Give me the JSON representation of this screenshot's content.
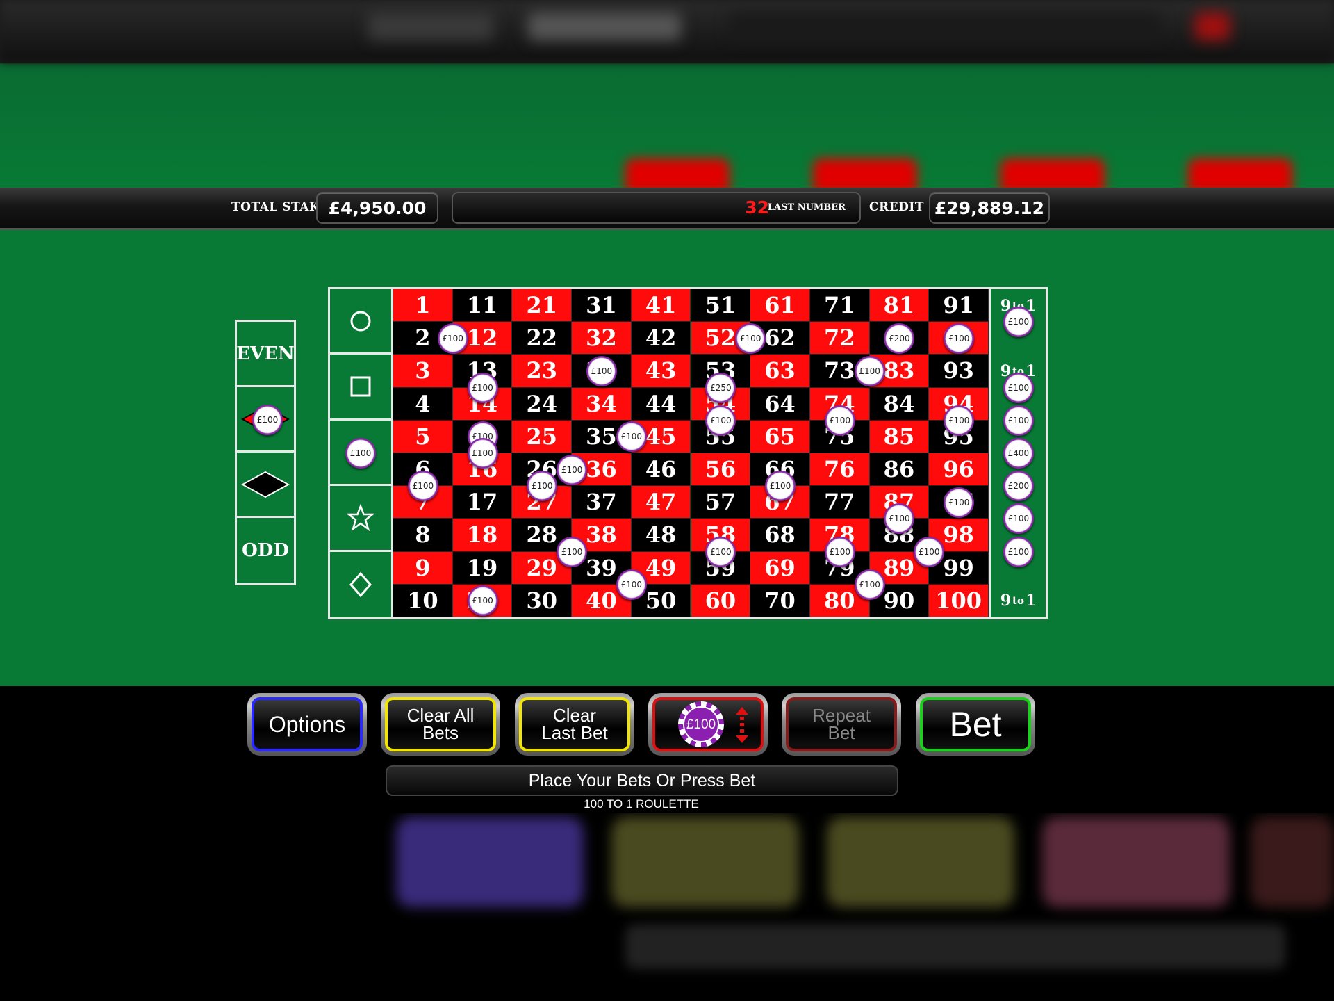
{
  "info_bar": {
    "total_stake_label": "TOTAL STAKE",
    "total_stake_value": "£4,950.00",
    "last_number_value": "32",
    "last_number_label": "LAST NUMBER",
    "credit_label": "CREDIT",
    "credit_value": "£29,889.12"
  },
  "side_bets": [
    "EVEN",
    "",
    "",
    "ODD"
  ],
  "payout_label": {
    "nine": "9",
    "to": "to",
    "one": "1"
  },
  "grid": {
    "columns": [
      [
        1,
        2,
        3,
        4,
        5,
        6,
        7,
        8,
        9,
        10
      ],
      [
        11,
        12,
        13,
        14,
        15,
        16,
        17,
        18,
        19,
        20
      ],
      [
        21,
        22,
        23,
        24,
        25,
        26,
        27,
        28,
        29,
        30
      ],
      [
        31,
        32,
        33,
        34,
        35,
        36,
        37,
        38,
        39,
        40
      ],
      [
        41,
        42,
        43,
        44,
        45,
        46,
        47,
        48,
        49,
        50
      ],
      [
        51,
        52,
        53,
        54,
        55,
        56,
        57,
        58,
        59,
        60
      ],
      [
        61,
        62,
        63,
        64,
        65,
        66,
        67,
        68,
        69,
        70
      ],
      [
        71,
        72,
        73,
        74,
        75,
        76,
        77,
        78,
        79,
        80
      ],
      [
        81,
        82,
        83,
        84,
        85,
        86,
        87,
        88,
        89,
        90
      ],
      [
        91,
        92,
        93,
        94,
        95,
        96,
        97,
        98,
        99,
        100
      ]
    ],
    "red_numbers": [
      1,
      3,
      5,
      7,
      9,
      12,
      14,
      16,
      18,
      20,
      21,
      23,
      25,
      27,
      29,
      32,
      34,
      36,
      38,
      40,
      41,
      43,
      45,
      47,
      49,
      52,
      54,
      56,
      58,
      60,
      61,
      63,
      65,
      67,
      69,
      72,
      74,
      76,
      78,
      80,
      81,
      83,
      85,
      87,
      89,
      92,
      94,
      96,
      98,
      100
    ]
  },
  "chips": [
    {
      "label": "£100",
      "col": 1,
      "row": 1.5
    },
    {
      "label": "£100",
      "col": 1.5,
      "row": 3
    },
    {
      "label": "£100",
      "col": 1.5,
      "row": 4.5
    },
    {
      "label": "£100",
      "col": 1.5,
      "row": 5
    },
    {
      "label": "£100",
      "col": 1.5,
      "row": 9.5
    },
    {
      "label": "£100",
      "col": 0.5,
      "row": 6
    },
    {
      "label": "£100",
      "col": 2.5,
      "row": 6
    },
    {
      "label": "£100",
      "col": 3.5,
      "row": 2.5
    },
    {
      "label": "£100",
      "col": 3,
      "row": 5.5
    },
    {
      "label": "£100",
      "col": 3,
      "row": 8
    },
    {
      "label": "£100",
      "col": 4,
      "row": 4.5
    },
    {
      "label": "£100",
      "col": 4,
      "row": 9
    },
    {
      "label": "£250",
      "col": 5.5,
      "row": 3
    },
    {
      "label": "£100",
      "col": 5.5,
      "row": 4
    },
    {
      "label": "£100",
      "col": 5.5,
      "row": 8
    },
    {
      "label": "£100",
      "col": 6,
      "row": 1.5
    },
    {
      "label": "£100",
      "col": 6.5,
      "row": 6
    },
    {
      "label": "£100",
      "col": 7.5,
      "row": 4
    },
    {
      "label": "£100",
      "col": 7.5,
      "row": 8
    },
    {
      "label": "£100",
      "col": 8,
      "row": 2.5
    },
    {
      "label": "£100",
      "col": 8,
      "row": 9
    },
    {
      "label": "£200",
      "col": 8.5,
      "row": 1.5
    },
    {
      "label": "£100",
      "col": 8.5,
      "row": 7
    },
    {
      "label": "£100",
      "col": 9,
      "row": 8
    },
    {
      "label": "£100",
      "col": 9.5,
      "row": 1.5
    },
    {
      "label": "£100",
      "col": 9.5,
      "row": 4
    },
    {
      "label": "£100",
      "col": 9.5,
      "row": 6.5
    },
    {
      "label": "£100",
      "col": 10.5,
      "row": 1
    },
    {
      "label": "£100",
      "col": 10.5,
      "row": 3
    },
    {
      "label": "£100",
      "col": 10.5,
      "row": 4
    },
    {
      "label": "£400",
      "col": 10.5,
      "row": 5
    },
    {
      "label": "£200",
      "col": 10.5,
      "row": 6
    },
    {
      "label": "£100",
      "col": 10.5,
      "row": 7
    },
    {
      "label": "£100",
      "col": 10.5,
      "row": 8
    }
  ],
  "shape_chip": "£100",
  "side_chip": "£100",
  "buttons": {
    "options": "Options",
    "clear_all_1": "Clear All",
    "clear_all_2": "Bets",
    "clear_last_1": "Clear",
    "clear_last_2": "Last Bet",
    "chip_value": "£100",
    "repeat_1": "Repeat",
    "repeat_2": "Bet",
    "bet": "Bet"
  },
  "message": "Place Your Bets Or Press Bet",
  "game_title": "100 TO 1 ROULETTE",
  "colors": {
    "red": "#ff0b0b",
    "black": "#000000",
    "felt": "#087a35",
    "chip": "#8a1fb0"
  }
}
